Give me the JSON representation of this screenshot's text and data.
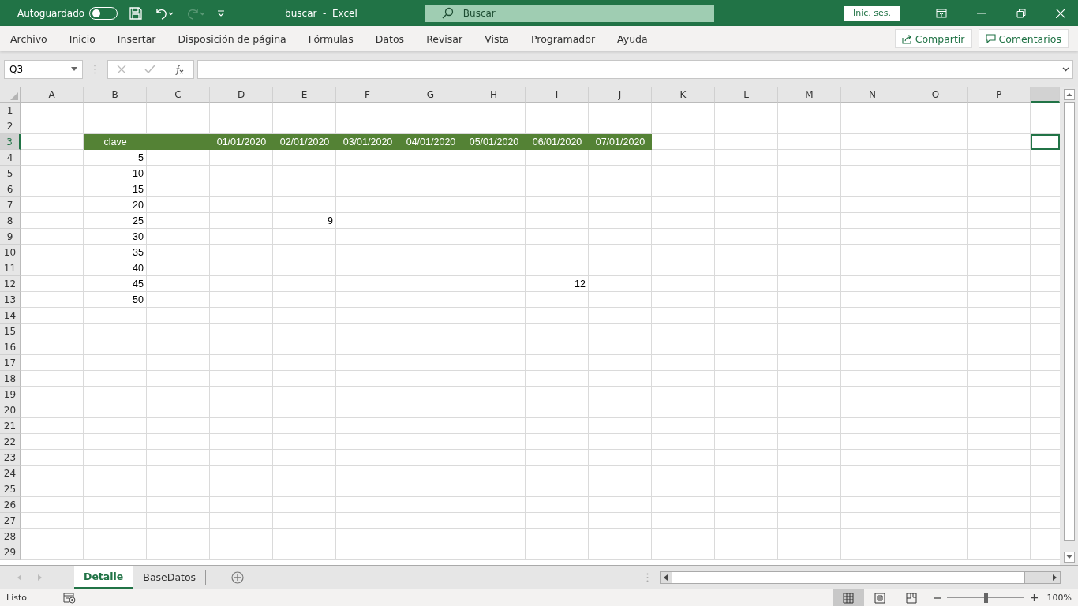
{
  "title_bar": {
    "autosave_label": "Autoguardado",
    "autosave_on": false,
    "redo_disabled": true,
    "title": "buscar  -  Excel",
    "search": {
      "placeholder": "Buscar"
    },
    "sign_in": "Inic. ses."
  },
  "ribbon": {
    "tabs": [
      {
        "label": "Archivo",
        "selected": false
      },
      {
        "label": "Inicio",
        "selected": false
      },
      {
        "label": "Insertar",
        "selected": false
      },
      {
        "label": "Disposición de página",
        "selected": false
      },
      {
        "label": "Fórmulas",
        "selected": false
      },
      {
        "label": "Datos",
        "selected": false
      },
      {
        "label": "Revisar",
        "selected": false
      },
      {
        "label": "Vista",
        "selected": false
      },
      {
        "label": "Programador",
        "selected": false
      },
      {
        "label": "Ayuda",
        "selected": false
      }
    ],
    "share": "Compartir",
    "comments": "Comentarios"
  },
  "formula_bar": {
    "name_box": "Q3"
  },
  "sheet": {
    "columns": [
      {
        "label": "A",
        "selected": false
      },
      {
        "label": "B",
        "selected": false
      },
      {
        "label": "C",
        "selected": false
      },
      {
        "label": "D",
        "selected": false
      },
      {
        "label": "E",
        "selected": false
      },
      {
        "label": "F",
        "selected": false
      },
      {
        "label": "G",
        "selected": false
      },
      {
        "label": "H",
        "selected": false
      },
      {
        "label": "I",
        "selected": false
      },
      {
        "label": "J",
        "selected": false
      },
      {
        "label": "K",
        "selected": false
      },
      {
        "label": "L",
        "selected": false
      },
      {
        "label": "M",
        "selected": false
      },
      {
        "label": "N",
        "selected": false
      },
      {
        "label": "O",
        "selected": false
      },
      {
        "label": "P",
        "selected": false
      },
      {
        "selected": true
      }
    ],
    "rows": [
      {
        "label": "1",
        "selected": false
      },
      {
        "label": "2",
        "selected": false
      },
      {
        "label": "3",
        "selected": true,
        "kind": "header",
        "cells": {
          "B": "clave",
          "D": "01/01/2020",
          "E": "02/01/2020",
          "F": "03/01/2020",
          "G": "04/01/2020",
          "H": "05/01/2020",
          "I": "06/01/2020",
          "J": "07/01/2020"
        }
      },
      {
        "label": "4",
        "selected": false,
        "cells": {
          "B": "5"
        }
      },
      {
        "label": "5",
        "selected": false,
        "cells": {
          "B": "10"
        }
      },
      {
        "label": "6",
        "selected": false,
        "cells": {
          "B": "15"
        }
      },
      {
        "label": "7",
        "selected": false,
        "cells": {
          "B": "20"
        }
      },
      {
        "label": "8",
        "selected": false,
        "cells": {
          "B": "25",
          "E": "9"
        }
      },
      {
        "label": "9",
        "selected": false,
        "cells": {
          "B": "30"
        }
      },
      {
        "label": "10",
        "selected": false,
        "cells": {
          "B": "35"
        }
      },
      {
        "label": "11",
        "selected": false,
        "cells": {
          "B": "40"
        }
      },
      {
        "label": "12",
        "selected": false,
        "cells": {
          "B": "45",
          "I": "12"
        }
      },
      {
        "label": "13",
        "selected": false,
        "cells": {
          "B": "50"
        }
      },
      {
        "label": "14",
        "selected": false
      },
      {
        "label": "15",
        "selected": false
      },
      {
        "label": "16",
        "selected": false
      },
      {
        "label": "17",
        "selected": false
      },
      {
        "label": "18",
        "selected": false
      },
      {
        "label": "19",
        "selected": false
      },
      {
        "label": "20",
        "selected": false
      },
      {
        "label": "21",
        "selected": false
      },
      {
        "label": "22",
        "selected": false
      },
      {
        "label": "23",
        "selected": false
      },
      {
        "label": "24",
        "selected": false
      },
      {
        "label": "25",
        "selected": false
      },
      {
        "label": "26",
        "selected": false
      },
      {
        "label": "27",
        "selected": false
      },
      {
        "label": "28",
        "selected": false
      },
      {
        "label": "29",
        "selected": false
      }
    ]
  },
  "sheet_tabs": [
    {
      "label": "Detalle",
      "selected": true
    },
    {
      "label": "BaseDatos",
      "selected": false
    }
  ],
  "status_bar": {
    "status": "Listo",
    "views": [
      {
        "kind": "normal",
        "selected": true
      },
      {
        "kind": "page_layout",
        "selected": false
      },
      {
        "kind": "page_break",
        "selected": false
      }
    ],
    "zoom": {
      "level": 0.5,
      "reading": "100%"
    }
  }
}
